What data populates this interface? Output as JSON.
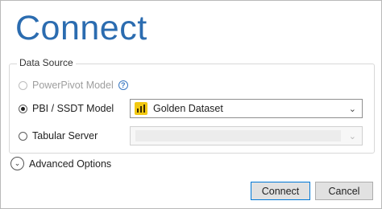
{
  "dialog": {
    "title": "Connect"
  },
  "data_source": {
    "legend": "Data Source",
    "options": [
      {
        "label": "PowerPivot Model",
        "selected": false,
        "enabled": false,
        "has_help": true
      },
      {
        "label": "PBI / SSDT Model",
        "selected": true,
        "enabled": true,
        "dropdown_value": "Golden Dataset",
        "dropdown_icon": "dataset-icon"
      },
      {
        "label": "Tabular Server",
        "selected": false,
        "enabled": true,
        "dropdown_value": ""
      }
    ],
    "help_glyph": "?"
  },
  "advanced": {
    "label": "Advanced Options"
  },
  "buttons": {
    "connect": "Connect",
    "cancel": "Cancel"
  },
  "colors": {
    "title": "#2b6cb0",
    "accent": "#0078d7",
    "dataset_icon": "#f2c811"
  }
}
